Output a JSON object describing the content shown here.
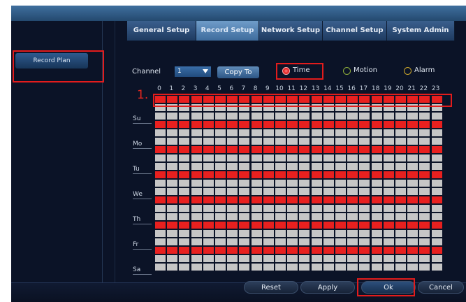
{
  "tabs": [
    "General Setup",
    "Record Setup",
    "Network Setup",
    "Channel Setup",
    "System Admin"
  ],
  "active_tab": "Record Setup",
  "sidebar": {
    "record_plan": "Record Plan"
  },
  "controls": {
    "channel_label": "Channel",
    "channel_value": "1",
    "copy_to": "Copy To",
    "mode_time": "Time",
    "mode_motion": "Motion",
    "mode_alarm": "Alarm",
    "selected_mode": "Time"
  },
  "hours": [
    "0",
    "1",
    "2",
    "3",
    "4",
    "5",
    "6",
    "7",
    "8",
    "9",
    "10",
    "11",
    "12",
    "13",
    "14",
    "15",
    "16",
    "17",
    "18",
    "19",
    "20",
    "21",
    "22",
    "23"
  ],
  "days": [
    "Su",
    "Mo",
    "Tu",
    "We",
    "Th",
    "Fr",
    "Sa"
  ],
  "annotation": "1.",
  "buttons": {
    "reset": "Reset",
    "apply": "Apply",
    "ok": "Ok",
    "cancel": "Cancel"
  },
  "colors": {
    "scheduled": "#e8201f",
    "unscheduled": "#c6c6c6",
    "highlight": "#e21c1c",
    "accent": "#3e6c9d"
  },
  "icons": {
    "dropdown": "chevron-down-icon",
    "radio": "radio-icon"
  }
}
